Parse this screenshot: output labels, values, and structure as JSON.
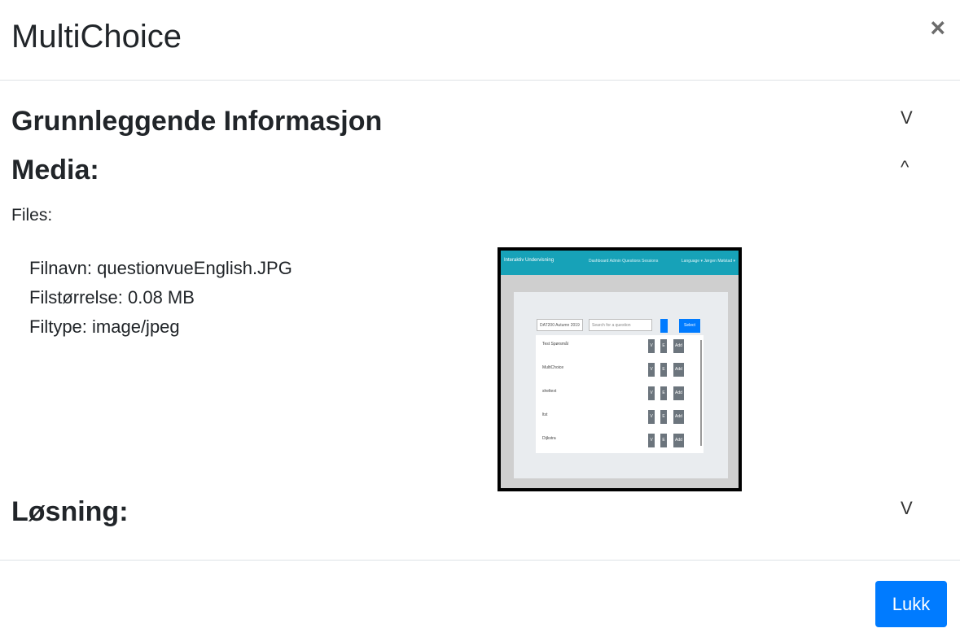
{
  "modal": {
    "title": "MultiChoice",
    "close_symbol": "×",
    "footer_button": "Lukk"
  },
  "sections": {
    "basic": {
      "title": "Grunnleggende Informasjon",
      "toggle": "V"
    },
    "media": {
      "title": "Media:",
      "toggle": "^"
    },
    "solution": {
      "title": "Løsning:",
      "toggle": "V"
    }
  },
  "media": {
    "files_label": "Files:",
    "file_name": "Filnavn: questionvueEnglish.JPG",
    "file_size": "Filstørrelse: 0.08 MB",
    "file_type": "Filtype: image/jpeg"
  },
  "preview": {
    "brand": "Interaktiv Undervisning",
    "nav_links": "Dashboard   Admin   Questions   Sessions",
    "nav_right": "Language ▾     Jørgen Mølstad ▾",
    "course_select": "DAT200 Autumn 2019",
    "search_placeholder": "Search for a question",
    "select_button": "Select",
    "rows": [
      "Test Spørsmål",
      "MultiChoice",
      "sheltext",
      "ltst",
      "Dijkstra"
    ],
    "btn_v": "V",
    "btn_e": "E",
    "btn_add": "Add"
  },
  "colors": {
    "primary": "#007bff",
    "navbar": "#17a2b8",
    "border": "#dee2e6"
  }
}
